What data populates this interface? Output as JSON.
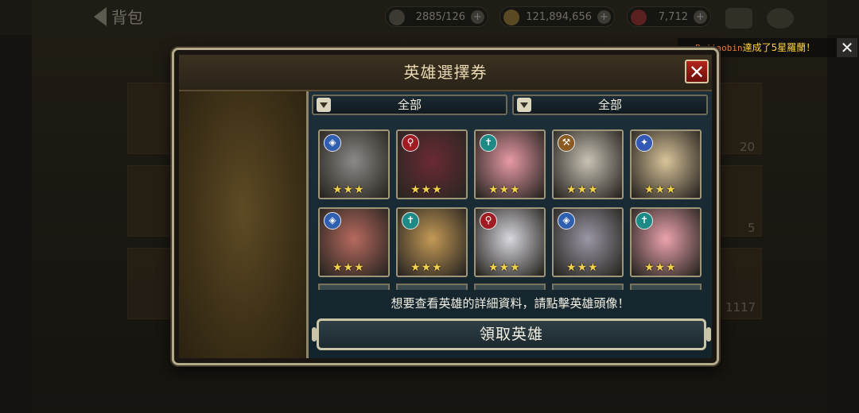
{
  "header": {
    "back_label": "背包",
    "stamina": "2885/126",
    "gold": "121,894,656",
    "ruby": "7,712"
  },
  "background": {
    "side_number_1": "20",
    "side_number_2": "5",
    "side_number_3": "1117"
  },
  "toast": {
    "player": "Pajiaobin",
    "message": "達成了5星羅蘭！"
  },
  "dialog": {
    "title": "英雄選擇券",
    "filter_left": "全部",
    "filter_right": "全部",
    "hint": "想要查看英雄的詳細資料，請點擊英雄頭像！",
    "claim_button": "領取英雄",
    "star_text": "★★★"
  },
  "heroes": [
    {
      "class": "shield",
      "class_color": "#2f5fb0",
      "portrait": "#8b8a86"
    },
    {
      "class": "wand",
      "class_color": "#a11b22",
      "portrait": "#6a2a33"
    },
    {
      "class": "cross",
      "class_color": "#1e8a86",
      "portrait": "#e79aa5"
    },
    {
      "class": "axe",
      "class_color": "#8a5a22",
      "portrait": "#c9c3b5"
    },
    {
      "class": "gun",
      "class_color": "#3359b5",
      "portrait": "#d9c49a"
    },
    {
      "class": "shield",
      "class_color": "#2f5fb0",
      "portrait": "#b76a5e"
    },
    {
      "class": "cross",
      "class_color": "#1e8a86",
      "portrait": "#c49a56"
    },
    {
      "class": "wand",
      "class_color": "#a11b22",
      "portrait": "#d8d8df"
    },
    {
      "class": "shield",
      "class_color": "#2f5fb0",
      "portrait": "#9a97a5"
    },
    {
      "class": "cross",
      "class_color": "#1e8a86",
      "portrait": "#eba3ad"
    }
  ]
}
